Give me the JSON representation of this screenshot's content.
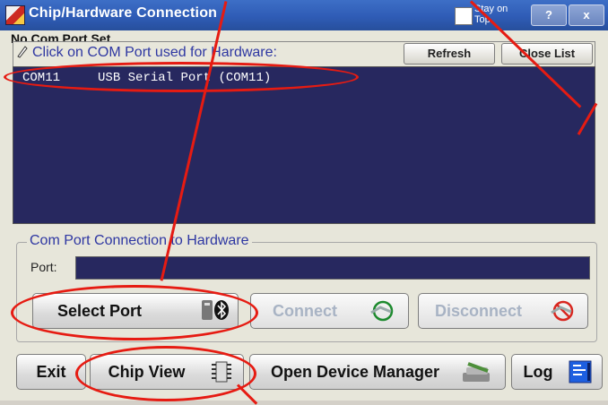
{
  "window": {
    "title": "Chip/Hardware Connection",
    "stay_on_top": "Stay on Top",
    "help_label": "?",
    "close_label": "x",
    "overlay_text": "No Com Port Set"
  },
  "port_list": {
    "instruction": "Click on COM Port used for Hardware:",
    "refresh_label": "Refresh",
    "close_list_label": "Close List",
    "rows": [
      {
        "port": "COM11",
        "description": "USB Serial Port (COM11)"
      }
    ]
  },
  "connection": {
    "group_title": "Com Port Connection to Hardware",
    "port_label": "Port:",
    "port_value": "",
    "select_port_label": "Select Port",
    "connect_label": "Connect",
    "disconnect_label": "Disconnect"
  },
  "toolbar": {
    "exit_label": "Exit",
    "chip_view_label": "Chip View",
    "device_manager_label": "Open Device Manager",
    "log_label": "Log"
  },
  "colors": {
    "accent_blue": "#2e37a2",
    "list_bg": "#27285f",
    "annotation_red": "#e61b12"
  },
  "icons": {
    "usb_bluetooth": "usb-bluetooth-icon",
    "connect": "connect-icon",
    "disconnect": "disconnect-icon",
    "chip": "chip-icon",
    "device_manager": "device-manager-icon",
    "log": "log-icon",
    "pointer": "pointer-icon"
  }
}
